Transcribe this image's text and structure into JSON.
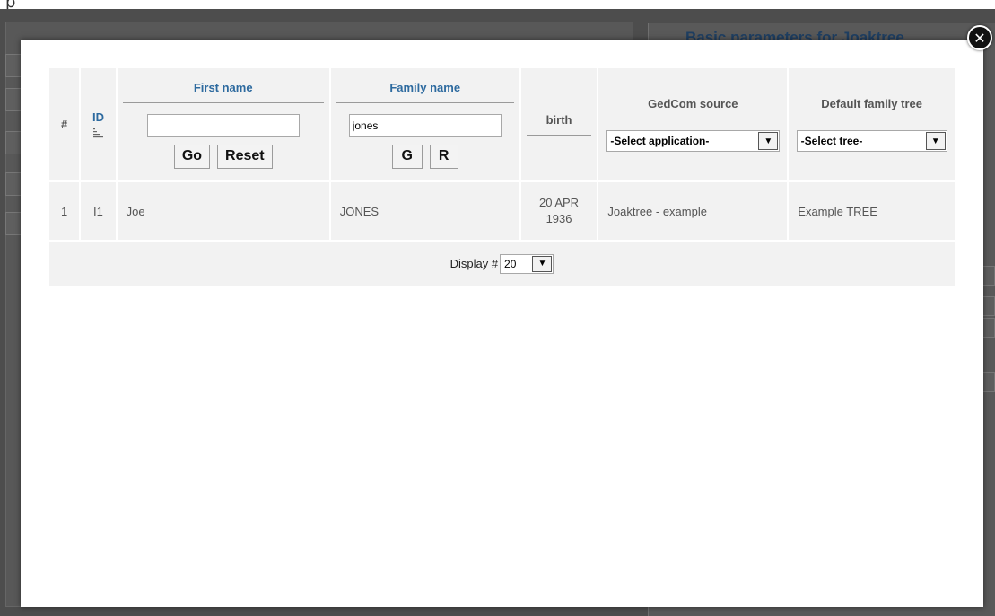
{
  "background": {
    "top_text": "p",
    "right_panel_title": "Basic parameters for Joaktree"
  },
  "table": {
    "headers": {
      "num": "#",
      "id": "ID",
      "first_name": "First name",
      "family_name": "Family name",
      "birth": "birth",
      "gedcom_source": "GedCom source",
      "default_tree": "Default family tree"
    },
    "filters": {
      "first_name_value": "",
      "family_name_value": "jones",
      "go_label": "Go",
      "reset_label": "Reset",
      "g_label": "G",
      "r_label": "R",
      "application_select": "-Select application-",
      "tree_select": "-Select tree-"
    },
    "rows": [
      {
        "num": "1",
        "id": "I1",
        "first_name": "Joe",
        "family_name": "JONES",
        "birth_line1": "20 APR",
        "birth_line2": "1936",
        "source": "Joaktree - example",
        "tree": "Example TREE"
      }
    ],
    "footer": {
      "display_label": "Display #",
      "display_value": "20"
    }
  },
  "icons": {
    "close": "close-icon",
    "sort": "sort-icon",
    "dropdown": "chevron-down-icon"
  }
}
